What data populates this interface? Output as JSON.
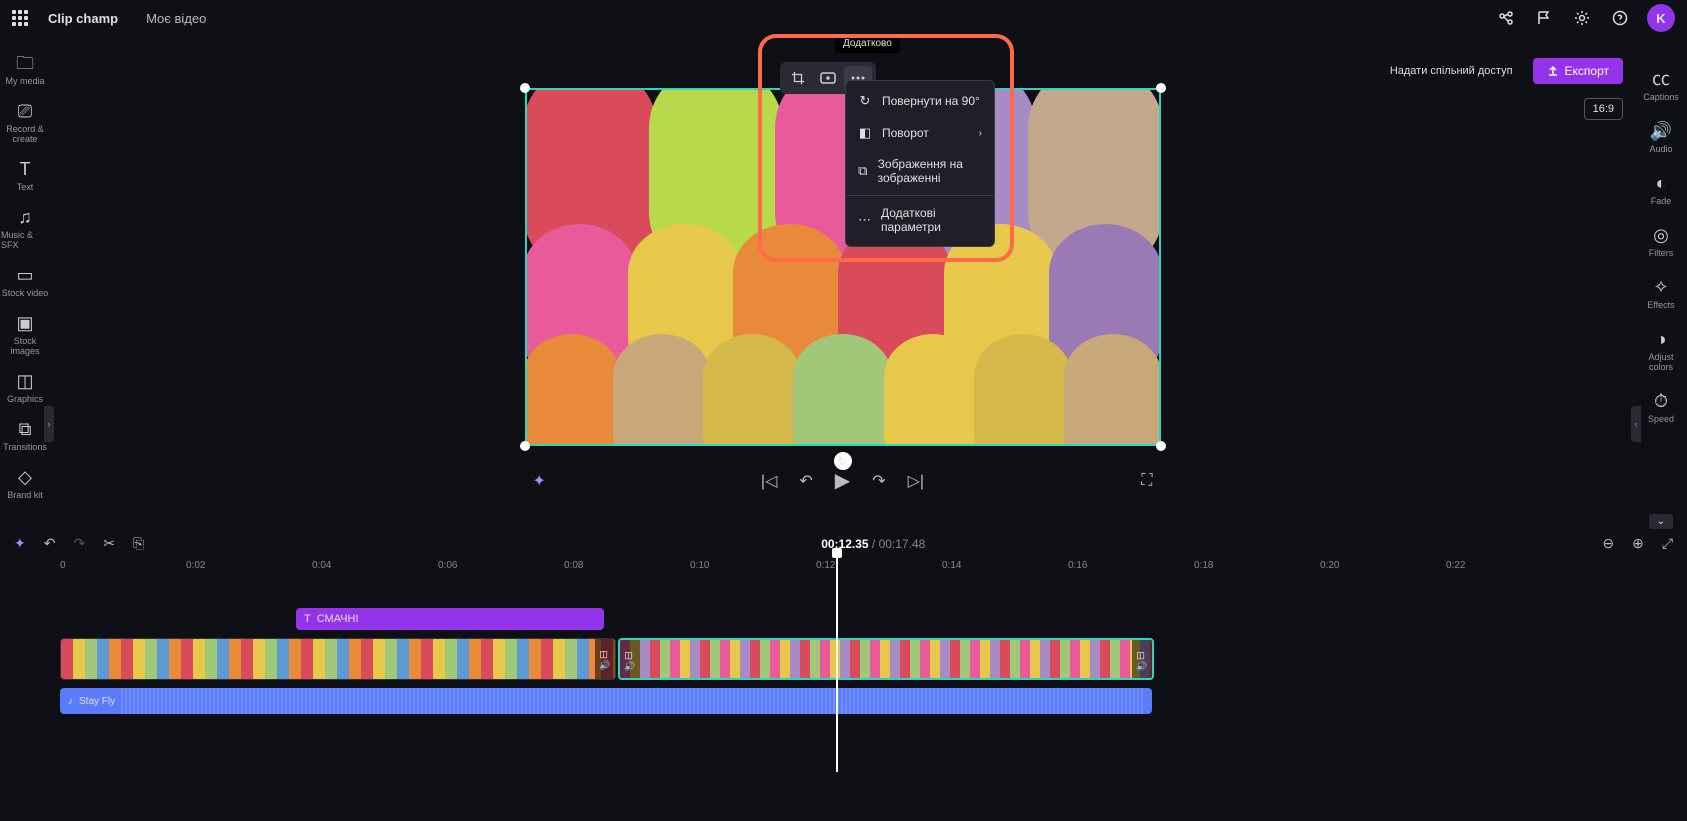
{
  "header": {
    "brand": "Clip champ",
    "project_name": "Моє відео",
    "avatar_initial": "K"
  },
  "left_rail": [
    {
      "label": "My media",
      "icon": "folder"
    },
    {
      "label": "Record & create",
      "icon": "camera"
    },
    {
      "label": "Text",
      "icon": "text"
    },
    {
      "label": "Music & SFX",
      "icon": "music"
    },
    {
      "label": "Stock video",
      "icon": "video"
    },
    {
      "label": "Stock images",
      "icon": "image"
    },
    {
      "label": "Graphics",
      "icon": "graphics"
    },
    {
      "label": "Transitions",
      "icon": "transitions"
    },
    {
      "label": "Brand kit",
      "icon": "brand"
    }
  ],
  "right_rail": [
    {
      "label": "Captions",
      "icon": "cc"
    },
    {
      "label": "Audio",
      "icon": "audio"
    },
    {
      "label": "Fade",
      "icon": "fade"
    },
    {
      "label": "Filters",
      "icon": "filters"
    },
    {
      "label": "Effects",
      "icon": "effects"
    },
    {
      "label": "Adjust colors",
      "icon": "adjust"
    },
    {
      "label": "Speed",
      "icon": "speed"
    }
  ],
  "top_actions": {
    "share": "Надати спільний доступ",
    "export": "Експорт",
    "aspect_ratio": "16:9"
  },
  "tooltip": {
    "additional": "Додатково"
  },
  "dropdown": {
    "rotate90": "Повернути на 90°",
    "flip": "Поворот",
    "pip": "Зображення на зображенні",
    "more_params": "Додаткові параметри"
  },
  "player": {
    "current_time": "00:12.35",
    "total_time": "00:17.48"
  },
  "ruler_marks": [
    "0",
    "0:02",
    "0:04",
    "0:06",
    "0:08",
    "0:10",
    "0:12",
    "0:14",
    "0:16",
    "0:18",
    "0:20",
    "0:22"
  ],
  "timeline": {
    "text_clip_label": "СМАЧНІ",
    "audio_clip_label": "Stay Fly"
  }
}
